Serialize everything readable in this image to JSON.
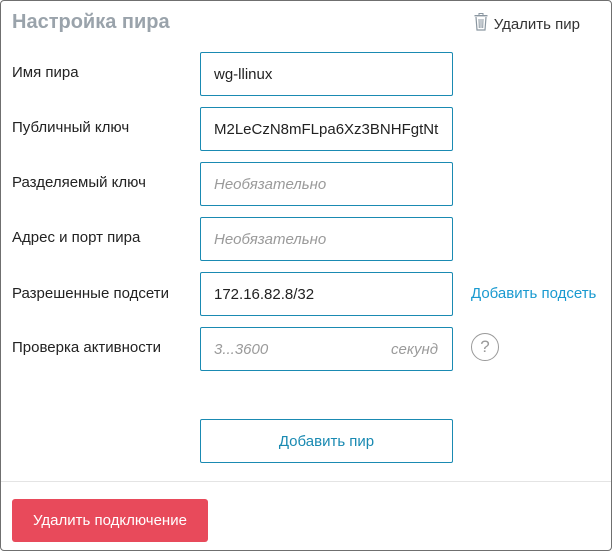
{
  "header": {
    "title": "Настройка пира",
    "delete_peer_label": "Удалить пир",
    "delete_icon": "trash-icon"
  },
  "form": {
    "peer_name": {
      "label": "Имя пира",
      "value": "wg-llinux",
      "placeholder": ""
    },
    "public_key": {
      "label": "Публичный ключ",
      "value": "M2LeCzN8mFLpa6Xz3BNHFgtNt",
      "placeholder": ""
    },
    "preshared_key": {
      "label": "Разделяемый ключ",
      "value": "",
      "placeholder": "Необязательно"
    },
    "endpoint": {
      "label": "Адрес и порт пира",
      "value": "",
      "placeholder": "Необязательно"
    },
    "allowed_ips": {
      "label": "Разрешенные подсети",
      "value": "172.16.82.8/32",
      "placeholder": "",
      "add_link": "Добавить подсеть"
    },
    "keepalive": {
      "label": "Проверка активности",
      "value": "",
      "placeholder": "3...3600",
      "unit": "секунд",
      "help_icon": "help-icon",
      "help_glyph": "?"
    }
  },
  "actions": {
    "add_peer_label": "Добавить пир",
    "delete_connection_label": "Удалить подключение"
  },
  "colors": {
    "accent": "#1a8ab2",
    "link": "#1a9ad0",
    "danger": "#e84a5b",
    "title": "#9aa3ab"
  }
}
